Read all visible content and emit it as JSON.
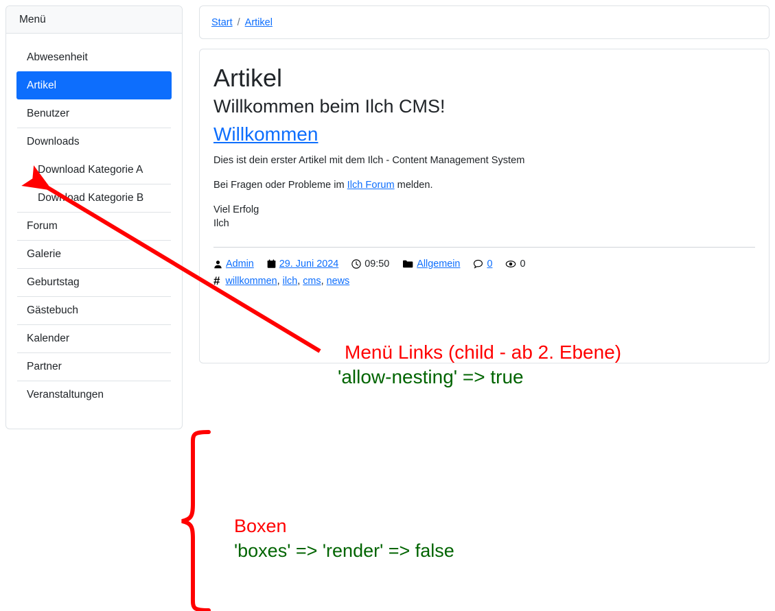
{
  "sidebar": {
    "header": "Menü",
    "items": [
      {
        "label": "Abwesenheit",
        "active": false,
        "child": false,
        "divider": false
      },
      {
        "label": "Artikel",
        "active": true,
        "child": false,
        "divider": false
      },
      {
        "label": "Benutzer",
        "active": false,
        "child": false,
        "divider": false
      },
      {
        "label": "Downloads",
        "active": false,
        "child": false,
        "divider": true
      },
      {
        "label": "Download Kategorie A",
        "active": false,
        "child": true,
        "divider": false
      },
      {
        "label": "Download Kategorie B",
        "active": false,
        "child": true,
        "divider": true
      },
      {
        "label": "Forum",
        "active": false,
        "child": false,
        "divider": true
      },
      {
        "label": "Galerie",
        "active": false,
        "child": false,
        "divider": true
      },
      {
        "label": "Geburtstag",
        "active": false,
        "child": false,
        "divider": true
      },
      {
        "label": "Gästebuch",
        "active": false,
        "child": false,
        "divider": true
      },
      {
        "label": "Kalender",
        "active": false,
        "child": false,
        "divider": true
      },
      {
        "label": "Partner",
        "active": false,
        "child": false,
        "divider": true
      },
      {
        "label": "Veranstaltungen",
        "active": false,
        "child": false,
        "divider": true
      }
    ]
  },
  "breadcrumb": {
    "home": "Start",
    "separator": "/",
    "current": "Artikel"
  },
  "article": {
    "title": "Artikel",
    "subtitle": "Willkommen beim Ilch CMS!",
    "link_heading": "Willkommen",
    "paragraph_1": "Dies ist dein erster Artikel mit dem Ilch - Content Management System",
    "paragraph_2_before": "Bei Fragen oder Probleme im ",
    "paragraph_2_link": "Ilch Forum",
    "paragraph_2_after": " melden.",
    "closing_line_1": "Viel Erfolg",
    "closing_line_2": "Ilch",
    "meta": {
      "author": "Admin",
      "date": "29. Juni 2024",
      "time": "09:50",
      "category": "Allgemein",
      "comments": "0",
      "views": "0",
      "author_icon": "person-icon",
      "date_icon": "calendar-icon",
      "time_icon": "clock-icon",
      "category_icon": "folder-icon",
      "comments_icon": "comment-icon",
      "views_icon": "eye-icon",
      "tags_icon": "hash-icon"
    },
    "tags": [
      "willkommen",
      "ilch",
      "cms",
      "news"
    ],
    "tag_separator": ","
  },
  "annotations": {
    "menu_links_red": "Menü Links (child - ab 2. Ebene)",
    "menu_links_green": "'allow-nesting' => true",
    "boxen_red": "Boxen",
    "boxen_green": "'boxes' => 'render' => false"
  },
  "colors": {
    "accent": "#0d6efd",
    "annotation_red": "#ff0000",
    "annotation_green": "#006400",
    "border": "#dee2e6",
    "header_bg": "#f8f9fa"
  }
}
